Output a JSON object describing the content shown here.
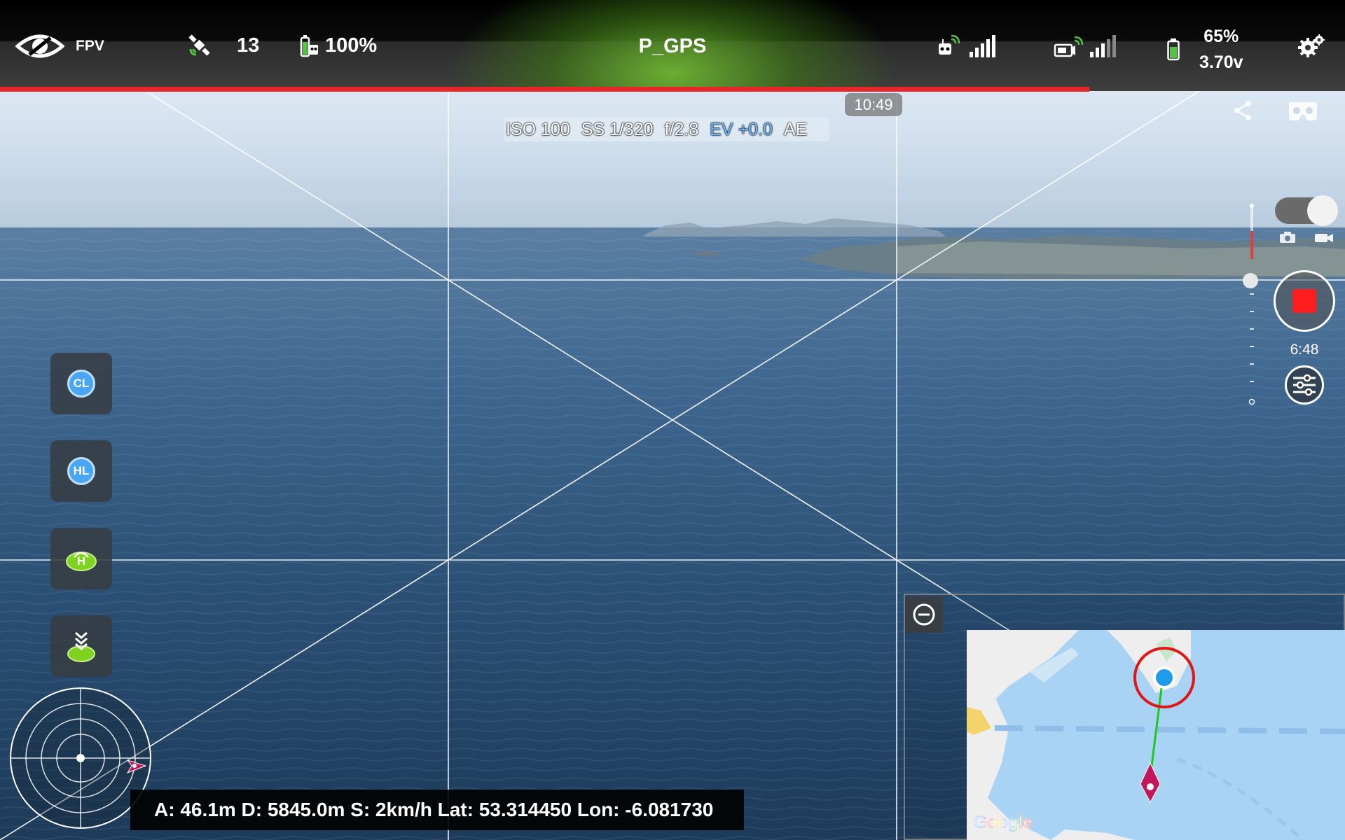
{
  "status_bar": {
    "view_mode": "FPV",
    "satellite_count": "13",
    "remote_battery": "100%",
    "flight_mode": "P_GPS",
    "aircraft_battery_percent": "65%",
    "aircraft_battery_voltage": "3.70v"
  },
  "camera": {
    "iso": "ISO 100",
    "shutter": "SS 1/320",
    "aperture": "f/2.8",
    "ev": "EV +0.0",
    "ae": "AE"
  },
  "flight_time": "10:49",
  "record_time": "6:48",
  "progress": {
    "flight_battery_fraction": 0.81
  },
  "left_buttons": {
    "cl_label": "CL",
    "hl_label": "HL"
  },
  "telemetry": "A: 46.1m D: 5845.0m S: 2km/h Lat: 53.314450 Lon: -6.081730",
  "map": {
    "attribution": "Google"
  },
  "icons": {
    "view": "eye-icon",
    "gps": "satellite-icon",
    "remote": "remote-controller-battery-icon",
    "rc_signal": "rc-signal-icon",
    "video_signal": "video-signal-icon",
    "battery": "battery-icon",
    "settings": "gear-icon",
    "share": "share-icon",
    "vr": "vr-headset-icon",
    "photo": "camera-icon",
    "video": "video-icon",
    "camera_settings": "sliders-icon",
    "minimap_collapse": "minus-circle-icon",
    "takeoff": "takeoff-icon",
    "land": "landing-icon",
    "aircraft": "aircraft-icon"
  },
  "colors": {
    "record": "#ff1e1e",
    "progress": "#e8262a",
    "ev": "#6ab8ff",
    "gps_icon": "#56c244",
    "button_badge": "#4aa6f2",
    "map_water": "#a9d3f5"
  }
}
